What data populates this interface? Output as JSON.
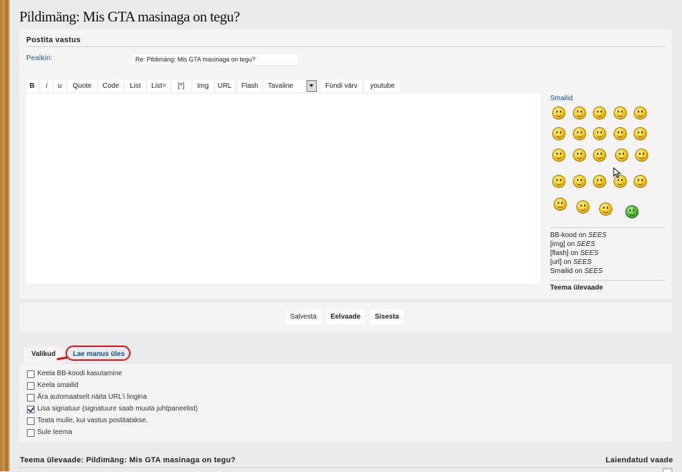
{
  "page": {
    "title": "Pildimäng: Mis GTA masinaga on tegu?"
  },
  "post": {
    "heading": "Postita vastus",
    "subject_label": "Pealkiri:",
    "subject_value": "Re: Pildimäng: Mis GTA masinaga on tegu?"
  },
  "toolbar": {
    "bold": "B",
    "italic": "i",
    "underline": "u",
    "quote": "Quote",
    "code": "Code",
    "list": "List",
    "list_ordered": "List=",
    "list_item": "[*]",
    "img": "Img",
    "url": "URL",
    "flash": "Flash",
    "font_size_value": "Tavaline",
    "font_color": "Fondi värv",
    "youtube": "youtube"
  },
  "sidebar": {
    "smilies_title": "Smailid",
    "status": [
      {
        "label": "BB-kood",
        "on": "on",
        "value": "SEES"
      },
      {
        "label": "[img]",
        "on": "on",
        "value": "SEES"
      },
      {
        "label": "[flash]",
        "on": "on",
        "value": "SEES"
      },
      {
        "label": "[url]",
        "on": "on",
        "value": "SEES"
      },
      {
        "label": "Smailid",
        "on": "on",
        "value": "SEES"
      }
    ],
    "topic_review": "Teema ülevaade"
  },
  "buttons": {
    "save": "Salvesta",
    "preview": "Eelvaade",
    "submit": "Sisesta"
  },
  "tabs": {
    "options": "Valikud",
    "upload": "Lae manus üles"
  },
  "options": [
    {
      "label": "Keela BB-koodi kasutamine",
      "checked": false
    },
    {
      "label": "Keela smailid",
      "checked": false
    },
    {
      "label": "Ära automaatselt näita URL'i lingina",
      "checked": false
    },
    {
      "label": "Lisa signatuur (signatuure saab muuta juhtpaneelist)",
      "checked": true
    },
    {
      "label": "Teata mulle, kui vastus postitatakse.",
      "checked": false
    },
    {
      "label": "Sule teema",
      "checked": false
    }
  ],
  "review": {
    "title": "Teema ülevaade: Pildimäng: Mis GTA masinaga on tegu?",
    "expanded": "Laiendatud vaade"
  },
  "colors": {
    "background": "#ebebee",
    "panel": "#f4f4f4",
    "link_blue": "#105289",
    "annotation_red": "#e01010"
  }
}
